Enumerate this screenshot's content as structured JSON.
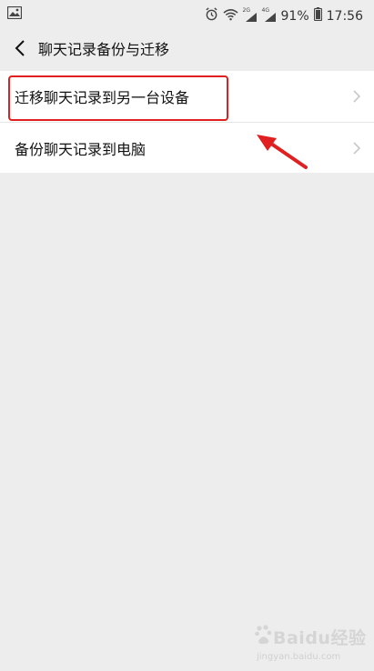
{
  "status_bar": {
    "battery_text": "91%",
    "time": "17:56",
    "network_labels": [
      "2G",
      "4G"
    ]
  },
  "header": {
    "title": "聊天记录备份与迁移"
  },
  "menu": {
    "items": [
      {
        "label": "迁移聊天记录到另一台设备",
        "icon": "chevron-right-icon"
      },
      {
        "label": "备份聊天记录到电脑",
        "icon": "chevron-right-icon"
      }
    ]
  },
  "watermark": {
    "brand": "Baidu经验",
    "url": "jingyan.baidu.com"
  },
  "colors": {
    "background": "#ededed",
    "highlight": "#e02020",
    "arrow": "#e02020"
  }
}
